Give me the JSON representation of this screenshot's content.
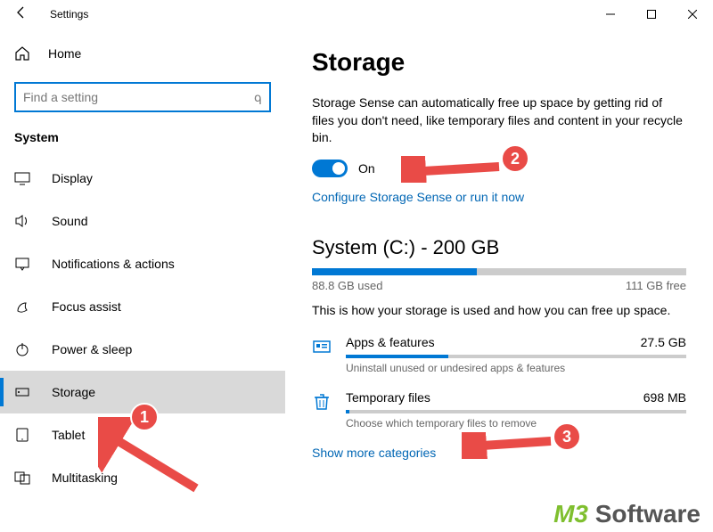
{
  "window": {
    "title": "Settings"
  },
  "sidebar": {
    "home": "Home",
    "search_placeholder": "Find a setting",
    "section": "System",
    "items": [
      {
        "label": "Display",
        "icon": "display",
        "selected": false
      },
      {
        "label": "Sound",
        "icon": "sound",
        "selected": false
      },
      {
        "label": "Notifications & actions",
        "icon": "notifications",
        "selected": false
      },
      {
        "label": "Focus assist",
        "icon": "focus",
        "selected": false
      },
      {
        "label": "Power & sleep",
        "icon": "power",
        "selected": false
      },
      {
        "label": "Storage",
        "icon": "storage",
        "selected": true
      },
      {
        "label": "Tablet",
        "icon": "tablet",
        "selected": false
      },
      {
        "label": "Multitasking",
        "icon": "multitasking",
        "selected": false
      }
    ]
  },
  "content": {
    "title": "Storage",
    "sense_description": "Storage Sense can automatically free up space by getting rid of files you don't need, like temporary files and content in your recycle bin.",
    "toggle_state": "On",
    "configure_link": "Configure Storage Sense or run it now",
    "drive_heading": "System (C:) - 200 GB",
    "used_pct": 44,
    "used_label": "88.8 GB used",
    "free_label": "111 GB free",
    "explain": "This is how your storage is used and how you can free up space.",
    "categories": [
      {
        "name": "Apps & features",
        "size": "27.5 GB",
        "hint": "Uninstall unused or undesired apps & features",
        "bar_pct": 30,
        "icon": "apps"
      },
      {
        "name": "Temporary files",
        "size": "698 MB",
        "hint": "Choose which temporary files to remove",
        "bar_pct": 1,
        "icon": "trash"
      }
    ],
    "show_more": "Show more categories"
  },
  "callouts": {
    "n1": "1",
    "n2": "2",
    "n3": "3"
  },
  "watermark": {
    "a": "M3",
    "b": "Software"
  }
}
